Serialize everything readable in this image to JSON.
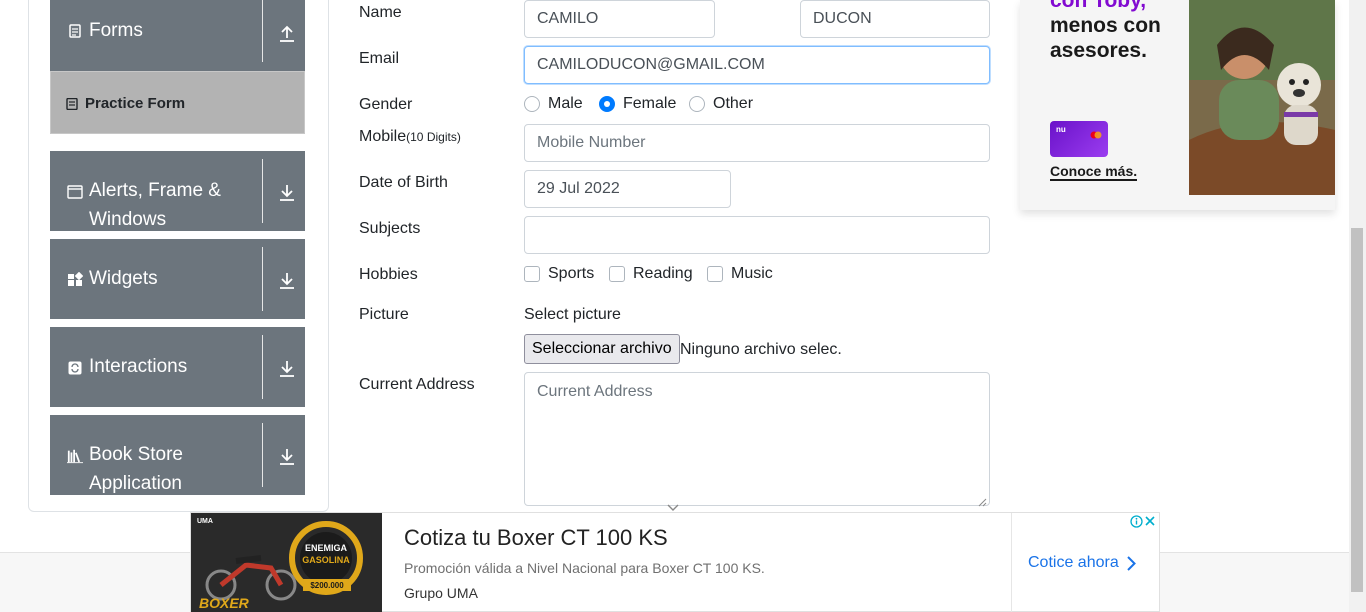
{
  "sidebar": {
    "groups": [
      {
        "label": "Forms",
        "icon": "form-icon",
        "arrow": "arrow-up-icon"
      },
      {
        "label": "Alerts, Frame & Windows",
        "label_line1": "Alerts, Frame &",
        "label_line2": "Windows",
        "icon": "window-icon",
        "arrow": "arrow-down-icon"
      },
      {
        "label": "Widgets",
        "icon": "widgets-icon",
        "arrow": "arrow-down-icon"
      },
      {
        "label": "Interactions",
        "icon": "interactions-icon",
        "arrow": "arrow-down-icon"
      },
      {
        "label": "Book Store Application",
        "label_line1": "Book Store",
        "label_line2": "Application",
        "icon": "books-icon",
        "arrow": "arrow-down-icon"
      }
    ],
    "active_item": {
      "label": "Practice Form",
      "icon": "form-icon"
    }
  },
  "form": {
    "name_label": "Name",
    "first_name": "CAMILO",
    "last_name": "DUCON",
    "email_label": "Email",
    "email": "CAMILODUCON@GMAIL.COM",
    "gender_label": "Gender",
    "gender_options": [
      "Male",
      "Female",
      "Other"
    ],
    "gender_selected": "Female",
    "mobile_label": "Mobile",
    "mobile_hint": "(10 Digits)",
    "mobile_placeholder": "Mobile Number",
    "dob_label": "Date of Birth",
    "dob": "29 Jul 2022",
    "subjects_label": "Subjects",
    "subjects": "",
    "hobbies_label": "Hobbies",
    "hobbies": [
      "Sports",
      "Reading",
      "Music"
    ],
    "picture_label": "Picture",
    "picture_caption": "Select picture",
    "file_button": "Seleccionar archivo",
    "file_status": "Ninguno archivo selec.",
    "address_label": "Current Address",
    "address_placeholder": "Current Address"
  },
  "side_ad": {
    "line0": "con Toby,",
    "line1": "menos con",
    "line2": "asesores.",
    "card_brand": "nu",
    "cta": "Conoce más."
  },
  "bottom_ad": {
    "headline": "Cotiza tu Boxer CT 100 KS",
    "description": "Promoción válida a Nivel Nacional para Boxer CT 100 KS.",
    "advertiser": "Grupo UMA",
    "cta": "Cotice ahora",
    "thumb_brand": "UMA",
    "thumb_model": "BOXER",
    "thumb_line1": "ENEMIGA",
    "thumb_line2": "GASOLINA",
    "thumb_price": "$200.000"
  },
  "colors": {
    "accent": "#007bff",
    "sidebar_group": "#6c757d",
    "active_item": "#b3b3b3",
    "ad_purple": "#820ad1",
    "ad_link": "#1a73e8"
  }
}
